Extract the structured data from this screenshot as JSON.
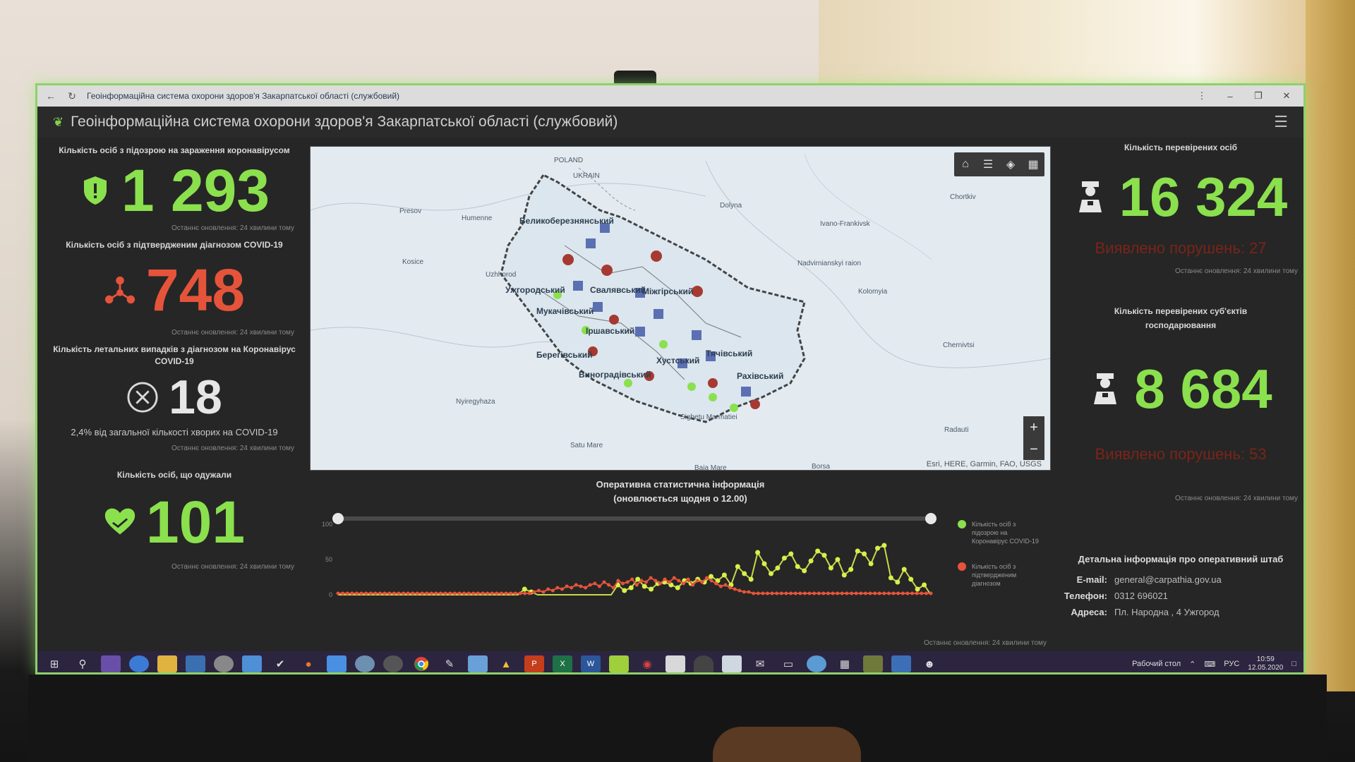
{
  "browser": {
    "back_icon": "back-arrow-icon",
    "refresh_icon": "refresh-icon",
    "tab_title": "Геоінформаційна система охорони здоров'я Закарпатської області (службовий)"
  },
  "app": {
    "title": "Геоінформаційна система охорони здоров'я Закарпатської області (службовий)"
  },
  "left": {
    "suspected": {
      "label": "Кількість осіб з підозрою на зараження коронавірусом",
      "value": "1 293",
      "note": "Останнє оновлення: 24 хвилини тому",
      "color": "#8be04e"
    },
    "confirmed": {
      "label": "Кількість осіб з підтвердженим діагнозом COVID-19",
      "value": "748",
      "note": "Останнє оновлення: 24 хвилини тому",
      "color": "#e5543a"
    },
    "deaths": {
      "label": "Кількість летальних випадків з діагнозом на Коронавірус COVID-19",
      "value": "18",
      "sub": "2,4% від загальної кількості хворих на COVID-19",
      "note": "Останнє оновлення: 24 хвилини тому"
    },
    "recovered": {
      "label": "Кількість осіб, що одужали",
      "value": "101",
      "note": "Останнє оновлення: 24 хвилини тому",
      "color": "#8be04e"
    }
  },
  "map": {
    "attribution": "Esri, HERE, Garmin, FAO, USGS",
    "labels": [
      "POLAND",
      "UKRAIN",
      "Dolyna",
      "Chortkiv",
      "Ivano-Frankivsk",
      "Nadvirnianskyi raion",
      "Kolomyia",
      "Chernivtsi",
      "Radauti",
      "Uzhhorod",
      "Presov",
      "Kosice",
      "Humenne",
      "Nyiregyhaza",
      "Satu Mare",
      "Baia Mare",
      "Borsa",
      "Sighetu Marmatiei",
      "Великоберезнянський",
      "Свалявський",
      "Міжгірський",
      "Мукачівський",
      "Іршавський",
      "Берегівський",
      "Виноградівський",
      "Хустський",
      "Тячівський",
      "Рахівський",
      "Ужгородський"
    ],
    "toolbar_icons": [
      "home-icon",
      "list-icon",
      "layers-icon",
      "basemap-icon"
    ],
    "zoom_in": "+",
    "zoom_out": "−"
  },
  "chart_section": {
    "title_line1": "Оперативна статистична інформація",
    "title_line2": "(оновлюється щодня о 12.00)",
    "legend": [
      {
        "label": "Кількість осіб з підозрою на Коронавірус COVID-19",
        "color": "#8be04e"
      },
      {
        "label": "Кількість осіб з підтвердженим діагнозом",
        "color": "#e5543a"
      }
    ],
    "note": "Останнє оновлення: 24 хвилини тому"
  },
  "chart_data": {
    "type": "line",
    "yticks": [
      "100",
      "50",
      "0"
    ],
    "ylim": [
      0,
      100
    ],
    "series": [
      {
        "name": "Кількість осіб з підозрою на Коронавірус COVID-19",
        "values": [
          0,
          0,
          0,
          0,
          0,
          0,
          0,
          0,
          0,
          0,
          0,
          0,
          0,
          0,
          0,
          0,
          0,
          0,
          0,
          0,
          0,
          0,
          0,
          0,
          0,
          0,
          0,
          0,
          8,
          4,
          0,
          0,
          0,
          0,
          0,
          0,
          0,
          0,
          0,
          0,
          0,
          0,
          14,
          6,
          10,
          22,
          12,
          8,
          16,
          18,
          14,
          10,
          20,
          16,
          22,
          18,
          26,
          20,
          28,
          14,
          40,
          30,
          22,
          60,
          44,
          30,
          38,
          52,
          58,
          40,
          34,
          48,
          62,
          56,
          38,
          50,
          28,
          36,
          62,
          58,
          44,
          66,
          70,
          24,
          18,
          36,
          22,
          8,
          14,
          0
        ]
      },
      {
        "name": "Кількість осіб з підтвердженим діагнозом",
        "values": [
          2,
          2,
          2,
          2,
          2,
          2,
          2,
          2,
          2,
          2,
          2,
          2,
          2,
          2,
          2,
          2,
          2,
          2,
          2,
          2,
          2,
          2,
          2,
          2,
          2,
          2,
          2,
          2,
          2,
          2,
          2,
          2,
          2,
          2,
          2,
          2,
          2,
          2,
          2,
          2,
          2,
          2,
          4,
          6,
          4,
          8,
          6,
          10,
          8,
          12,
          10,
          14,
          12,
          10,
          14,
          16,
          12,
          18,
          14,
          10,
          20,
          16,
          18,
          22,
          14,
          20,
          18,
          24,
          20,
          16,
          22,
          18,
          24,
          20,
          16,
          22,
          14,
          20,
          18,
          24,
          20,
          16,
          12,
          14,
          10,
          8,
          6,
          4,
          4,
          2,
          2,
          2,
          2,
          2,
          2,
          2,
          2,
          2,
          2,
          2,
          2,
          2,
          2,
          2,
          2,
          2,
          2,
          2,
          2,
          2,
          2,
          2,
          2,
          2,
          2,
          2,
          2,
          2,
          2,
          2,
          2,
          2,
          2,
          2,
          2,
          2,
          2,
          2
        ]
      }
    ]
  },
  "right": {
    "checked_persons": {
      "label": "Кількість перевірених осіб",
      "value": "16 324",
      "violations": "Виявлено порушень: 27",
      "note": "Останнє оновлення: 24 хвилини тому"
    },
    "checked_entities": {
      "label": "Кількість перевірених суб'єктів господарювання",
      "value": "8 684",
      "violations": "Виявлено порушень: 53",
      "note": "Останнє оновлення: 24 хвилини тому"
    },
    "contact": {
      "title": "Детальна інформація про оперативний штаб",
      "email_label": "E-mail:",
      "email": "general@carpathia.gov.ua",
      "phone_label": "Телефон:",
      "phone": "0312 696021",
      "address_label": "Адреса:",
      "address": "Пл. Народна , 4 Ужгород"
    }
  },
  "taskbar": {
    "desktop_label": "Рабочий стол",
    "lang": "РУС",
    "time": "10:59",
    "date": "12.05.2020"
  }
}
